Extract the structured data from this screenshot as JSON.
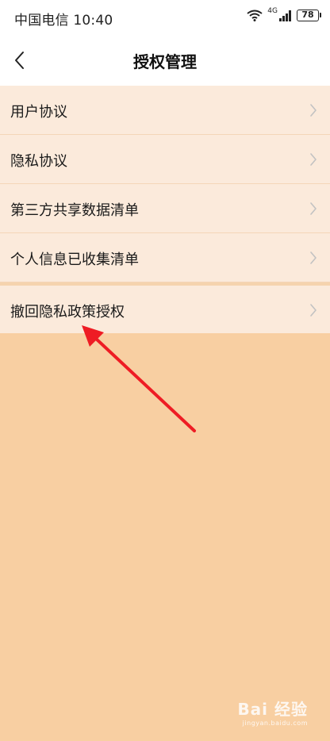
{
  "status_bar": {
    "carrier_time": "中国电信 10:40",
    "network": "4G",
    "battery": "78"
  },
  "header": {
    "title": "授权管理"
  },
  "menu": {
    "items": [
      {
        "label": "用户协议"
      },
      {
        "label": "隐私协议"
      },
      {
        "label": "第三方共享数据清单"
      },
      {
        "label": "个人信息已收集清单"
      }
    ],
    "revoke": {
      "label": "撤回隐私政策授权"
    }
  },
  "watermark": {
    "main": "Bai 经验",
    "sub": "jingyan.baidu.com"
  },
  "colors": {
    "page_background": "#f8cfa2",
    "list_item_background": "#fbeadb",
    "annotation_arrow": "#ee1c24"
  }
}
